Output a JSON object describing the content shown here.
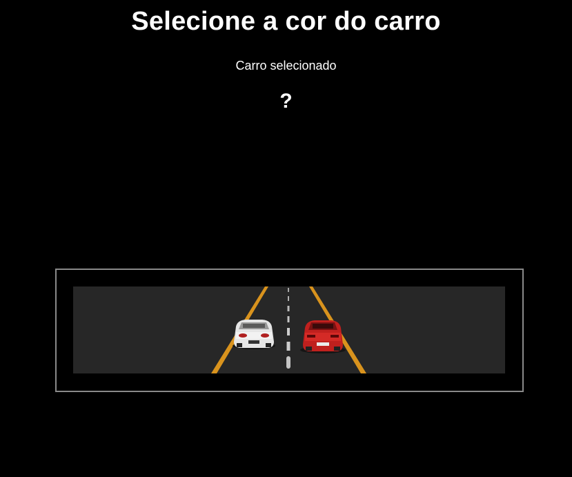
{
  "page": {
    "title": "Selecione a cor do carro",
    "selected_label": "Carro selecionado",
    "selected_value": "?"
  },
  "scene": {
    "road_color": "#272727",
    "lane_line_color": "#d9931d",
    "center_dash_color": "#e0e0e0",
    "frame_border_color": "#8a8a8a",
    "cars": [
      {
        "name": "white-car",
        "color": "#e6e6e6"
      },
      {
        "name": "red-car",
        "color": "#c0201e"
      }
    ]
  }
}
